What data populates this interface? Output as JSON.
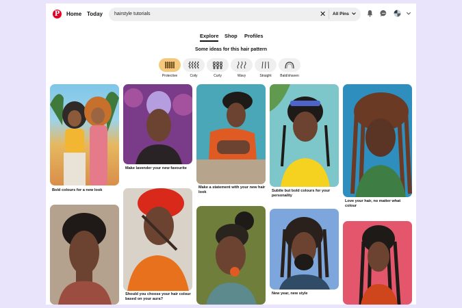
{
  "header": {
    "logo": "P",
    "home": "Home",
    "today": "Today",
    "search_value": "hairstyle tutorials",
    "search_filter": "All Pins",
    "icons": [
      "bell-icon",
      "chat-icon",
      "avatar",
      "chevron-down-icon"
    ]
  },
  "tabs": [
    {
      "label": "Explore",
      "active": true
    },
    {
      "label": "Shop",
      "active": false
    },
    {
      "label": "Profiles",
      "active": false
    }
  ],
  "ideas_heading": "Some ideas for this hair pattern",
  "hair_patterns": [
    {
      "label": "Protective",
      "active": true,
      "icon": "braids-icon"
    },
    {
      "label": "Coily",
      "active": false,
      "icon": "coily-icon"
    },
    {
      "label": "Curly",
      "active": false,
      "icon": "curly-icon"
    },
    {
      "label": "Wavy",
      "active": false,
      "icon": "wavy-icon"
    },
    {
      "label": "Straight",
      "active": false,
      "icon": "straight-icon"
    },
    {
      "label": "Bald/shaven",
      "active": false,
      "icon": "bald-icon"
    }
  ],
  "pins": [
    {
      "caption": "Bold colours for a new look"
    },
    {
      "caption": ""
    },
    {
      "caption": "Make lavender your new favourite"
    },
    {
      "caption": "Should you choose your hair colour based on your aura?"
    },
    {
      "caption": "Make a statement with your new hair look"
    },
    {
      "caption": ""
    },
    {
      "caption": "Subtle but bold colours for your personality"
    },
    {
      "caption": "New year, new style"
    },
    {
      "caption": "Love your hair, no matter what colour"
    },
    {
      "caption": ""
    }
  ],
  "colors": {
    "brand": "#e60023",
    "active_chip": "#f5c97d",
    "page_bg": "#e9e4fb"
  }
}
